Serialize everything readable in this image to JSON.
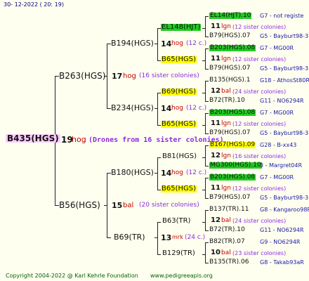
{
  "header": {
    "date": "30- 12-2022 ( 20: 19)"
  },
  "footer": {
    "copyright": "Copyright 2004-2022 @ Karl Kehrle Foundation",
    "site": "www.pedigreeapis.org"
  },
  "root": {
    "id": "B435(HGS)",
    "num": "19",
    "unit": "hog",
    "note": "(Drones from 16 sister colonies)"
  },
  "gen1": [
    {
      "id": "B263(HGS)",
      "num": "17",
      "unit": "hog",
      "note": "(16 sister colonies)"
    },
    {
      "id": "B56(HGS)",
      "num": "15",
      "unit": "bal",
      "note": "(20 sister colonies)"
    }
  ],
  "gen2": [
    {
      "id": "B194(HGS)",
      "num": "14",
      "unit": "hog",
      "note": "(12 c.)"
    },
    {
      "id": "B234(HGS)",
      "num": "14",
      "unit": "hog",
      "note": "(12 c.)"
    },
    {
      "id": "B180(HGS)",
      "num": "14",
      "unit": "hog",
      "note": "(12 c.)"
    },
    {
      "id": "B69(TR)",
      "num": "13",
      "unit": "mrk",
      "note": "(24 c.)"
    }
  ],
  "gen3": [
    {
      "id": "EL148(HJT)"
    },
    {
      "id": "B65(HGS)"
    },
    {
      "id": "B69(HGS)"
    },
    {
      "id": "B65(HGS)"
    },
    {
      "id": "B81(HGS)"
    },
    {
      "id": "B65(HGS)"
    },
    {
      "id": "B63(TR)"
    },
    {
      "id": "B129(TR)"
    }
  ],
  "gen4": [
    {
      "top": "EL14(HJT).10",
      "topNote": "G7 - not registe",
      "num": "11",
      "unit": "lgn",
      "note": "(12 sister colonies)",
      "bottom": "B79(HGS).07",
      "bottomNote": "G5 - Bayburt98-3"
    },
    {
      "top": "B203(HGS).08",
      "topNote": "G7 - MG00R",
      "num": "11",
      "unit": "lgn",
      "note": "(12 sister colonies)",
      "bottom": "B79(HGS).07",
      "bottomNote": "G5 - Bayburt98-3"
    },
    {
      "top": "B135(HGS).1",
      "topNote": "G18 - AthosSt80R",
      "num": "12",
      "unit": "bal",
      "note": "(24 sister colonies)",
      "bottom": "B72(TR).10",
      "bottomNote": "G11 - NO6294R"
    },
    {
      "top": "B203(HGS).08",
      "topNote": "G7 - MG00R",
      "num": "11",
      "unit": "lgn",
      "note": "(12 sister colonies)",
      "bottom": "B79(HGS).07",
      "bottomNote": "G5 - Bayburt98-3"
    },
    {
      "top": "B167(HGS).09",
      "topNote": "G28 - B-xx43",
      "num": "12",
      "unit": "lgn",
      "note": "(16 sister colonies)",
      "bottom": "MG300(HGS).10",
      "bottomNote": "3 - Margret04R"
    },
    {
      "top": "B203(HGS).08",
      "topNote": "G7 - MG00R",
      "num": "11",
      "unit": "lgn",
      "note": "(12 sister colonies)",
      "bottom": "B79(HGS).07",
      "bottomNote": "G5 - Bayburt98-3"
    },
    {
      "top": "B137(TR).11",
      "topNote": "G8 - Kangaroo98R",
      "num": "12",
      "unit": "bal",
      "note": "(24 sister colonies)",
      "bottom": "B72(TR).10",
      "bottomNote": "G11 - NO6294R"
    },
    {
      "top": "B82(TR).07",
      "topNote": "G9 - NO6294R",
      "num": "10",
      "unit": "bal",
      "note": "(23 sister colonies)",
      "bottom": "B135(TR).06",
      "bottomNote": "G8 - Takab93aR"
    }
  ]
}
